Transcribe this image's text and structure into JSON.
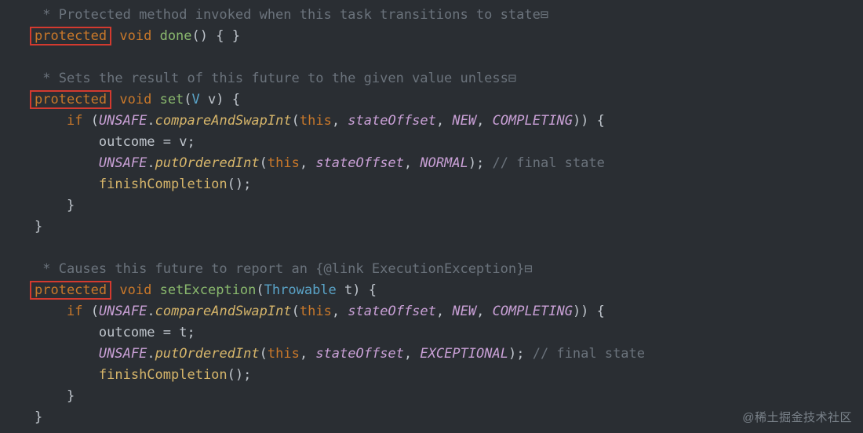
{
  "comments": {
    "done": "* Protected method invoked when this task transitions to state",
    "set": "* Sets the result of this future to the given value unless",
    "setEx": "* Causes this future to report an {@link ExecutionException}",
    "finalState": "// final state"
  },
  "glyph": {
    "fold": "⊟"
  },
  "kw": {
    "protected": "protected",
    "void": "void",
    "if": "if",
    "this": "this"
  },
  "methods": {
    "done": "done",
    "set": "set",
    "setException": "setException",
    "cas": "compareAndSwapInt",
    "putOrdered": "putOrderedInt",
    "finish": "finishCompletion"
  },
  "types": {
    "V": "V",
    "Throwable": "Throwable"
  },
  "ids": {
    "UNSAFE": "UNSAFE",
    "stateOffset": "stateOffset",
    "NEW": "NEW",
    "COMPLETING": "COMPLETING",
    "NORMAL": "NORMAL",
    "EXCEPTIONAL": "EXCEPTIONAL",
    "outcome": "outcome",
    "v": "v",
    "t": "t"
  },
  "watermark": "@稀土掘金技术社区"
}
